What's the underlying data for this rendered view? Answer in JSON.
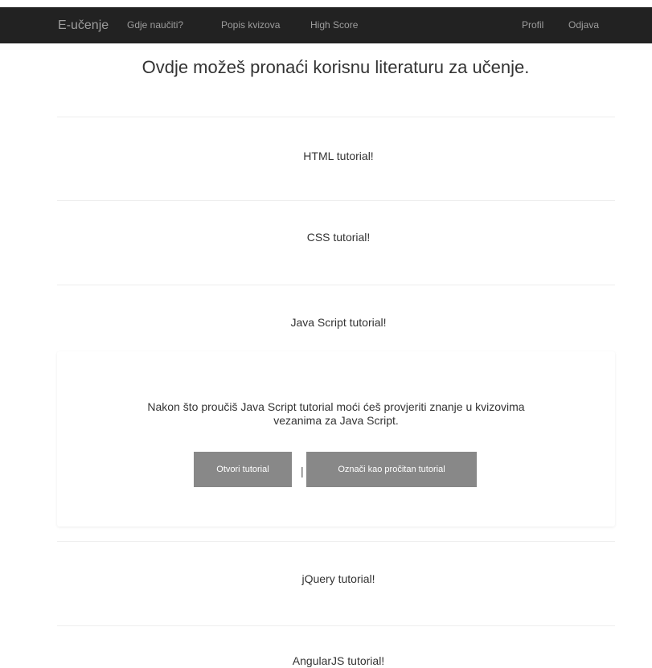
{
  "navbar": {
    "brand": "E-učenje",
    "left_links": [
      "Gdje naučiti?",
      "Popis kvizova",
      "High Score"
    ],
    "right_links": [
      "Profil",
      "Odjava"
    ],
    "background": "#222222",
    "link_color": "#9d9d9d"
  },
  "main": {
    "title": "Ovdje možeš pronaći korisnu literaturu za učenje.",
    "tutorials": [
      "HTML tutorial!",
      "CSS tutorial!",
      "Java Script tutorial!",
      "jQuery tutorial!",
      "AngularJS tutorial!"
    ],
    "expanded_panel": {
      "text_line1": "Nakon što proučiš Java Script tutorial moći ćeš provjeriti znanje u kvizovima",
      "text_line2": "vezanima za Java Script.",
      "open_button": "Otvori tutorial",
      "separator": "|",
      "mark_button": "Označi kao pročitan tutorial",
      "button_color": "#888888"
    }
  }
}
